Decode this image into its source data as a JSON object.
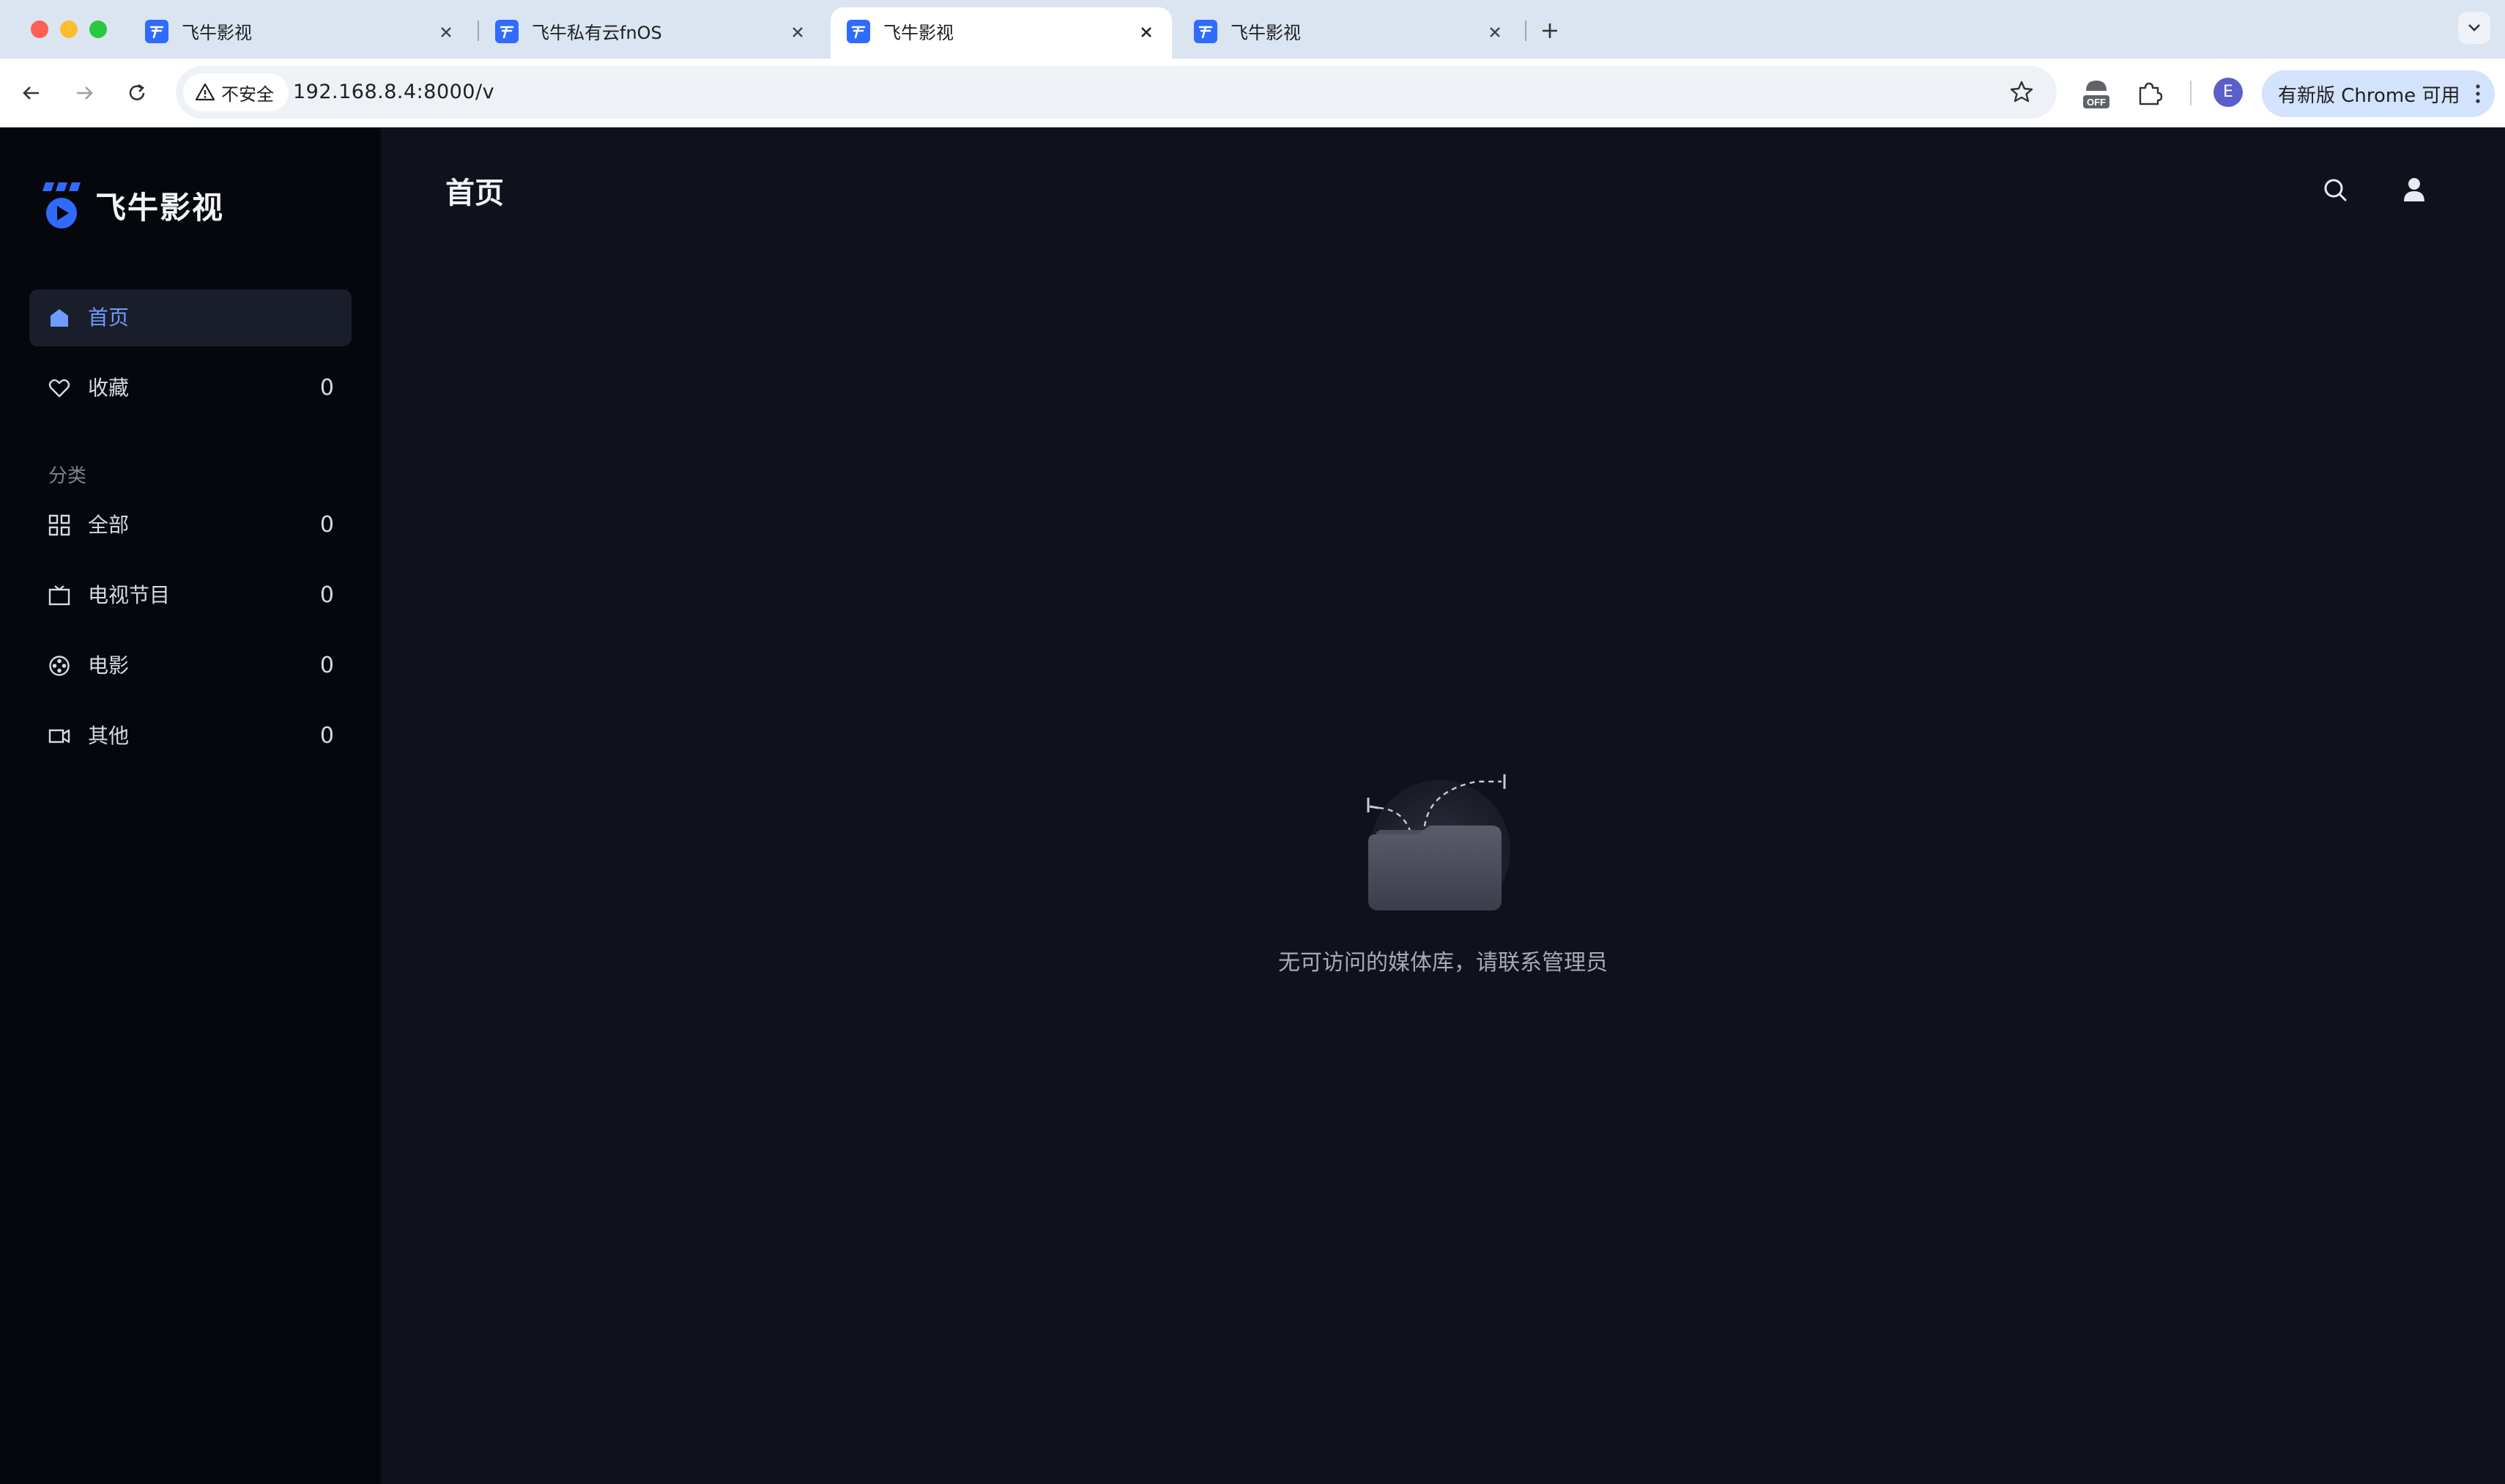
{
  "browser": {
    "tabs": [
      {
        "title": "飞牛影视",
        "active": false
      },
      {
        "title": "飞牛私有云fnOS",
        "active": false
      },
      {
        "title": "飞牛影视",
        "active": true
      },
      {
        "title": "飞牛影视",
        "active": false
      }
    ],
    "security_label": "不安全",
    "url": "192.168.8.4:8000/v",
    "extension_badge": "OFF",
    "profile_initial": "E",
    "update_label": "有新版 Chrome 可用"
  },
  "app": {
    "brand_name": "飞牛影视",
    "page_title": "首页",
    "sidebar": {
      "home": {
        "label": "首页",
        "icon": "home-icon"
      },
      "favorites": {
        "label": "收藏",
        "count": "0",
        "icon": "heart-icon"
      },
      "section_title": "分类",
      "categories": [
        {
          "label": "全部",
          "count": "0",
          "icon": "grid-icon"
        },
        {
          "label": "电视节目",
          "count": "0",
          "icon": "tv-icon"
        },
        {
          "label": "电影",
          "count": "0",
          "icon": "film-reel-icon"
        },
        {
          "label": "其他",
          "count": "0",
          "icon": "video-camera-icon"
        }
      ]
    },
    "empty_state": {
      "message": "无可访问的媒体库，请联系管理员",
      "icon": "empty-folder-icon"
    }
  },
  "colors": {
    "accent": "#6f9bff",
    "sidebar_bg": "#06070c",
    "main_bg": "#0f111c",
    "tabstrip_bg": "#dbe4f1"
  }
}
